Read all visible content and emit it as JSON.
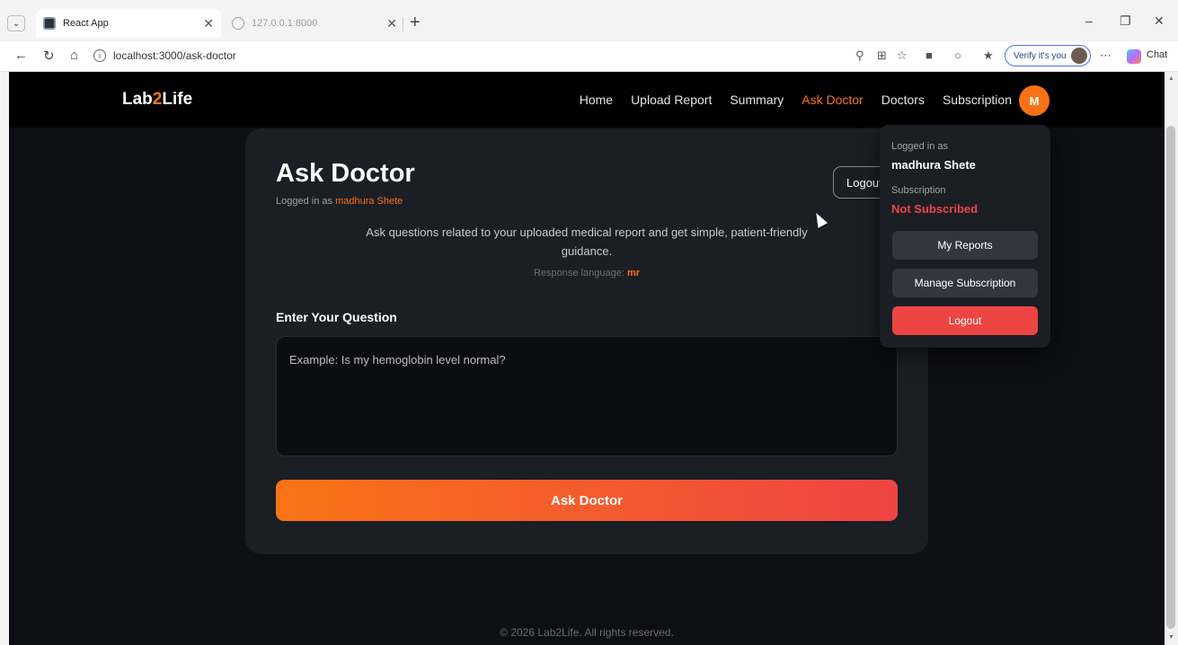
{
  "browser": {
    "tabs": [
      {
        "title": "React App",
        "active": true
      },
      {
        "title": "127.0.0.1:8000",
        "active": false
      }
    ],
    "url": "localhost:3000/ask-doctor",
    "verify_label": "Verify it's you",
    "chat_label": "Chat",
    "icons": {
      "tab_menu": "chevron-down-icon",
      "back": "back-arrow-icon",
      "reload": "reload-icon",
      "home": "home-icon",
      "info": "info-icon"
    }
  },
  "app": {
    "brand_prefix": "Lab",
    "brand_accent": "2",
    "brand_suffix": "Life",
    "nav": [
      {
        "label": "Home",
        "active": false
      },
      {
        "label": "Upload Report",
        "active": false
      },
      {
        "label": "Summary",
        "active": false
      },
      {
        "label": "Ask Doctor",
        "active": true
      },
      {
        "label": "Doctors",
        "active": false
      },
      {
        "label": "Subscription",
        "active": false
      }
    ],
    "avatar_initial": "M",
    "accent_color": "#f97316",
    "danger_color": "#ef4444"
  },
  "card": {
    "title": "Ask Doctor",
    "logged_prefix": "Logged in as",
    "user_name": "madhura Shete",
    "logout_label": "Logout",
    "description": "Ask questions related to your uploaded medical report and get simple, patient-friendly guidance.",
    "language_prefix": "Response language:",
    "language_code": "mr",
    "question_label": "Enter Your Question",
    "question_value": "",
    "question_placeholder": "Example: Is my hemoglobin level normal?",
    "ask_button": "Ask Doctor"
  },
  "dropdown": {
    "logged_label": "Logged in as",
    "user_name": "madhura Shete",
    "subscription_label": "Subscription",
    "subscription_status": "Not Subscribed",
    "my_reports": "My Reports",
    "manage_subscription": "Manage Subscription",
    "logout": "Logout"
  },
  "footer": "© 2026 Lab2Life. All rights reserved."
}
